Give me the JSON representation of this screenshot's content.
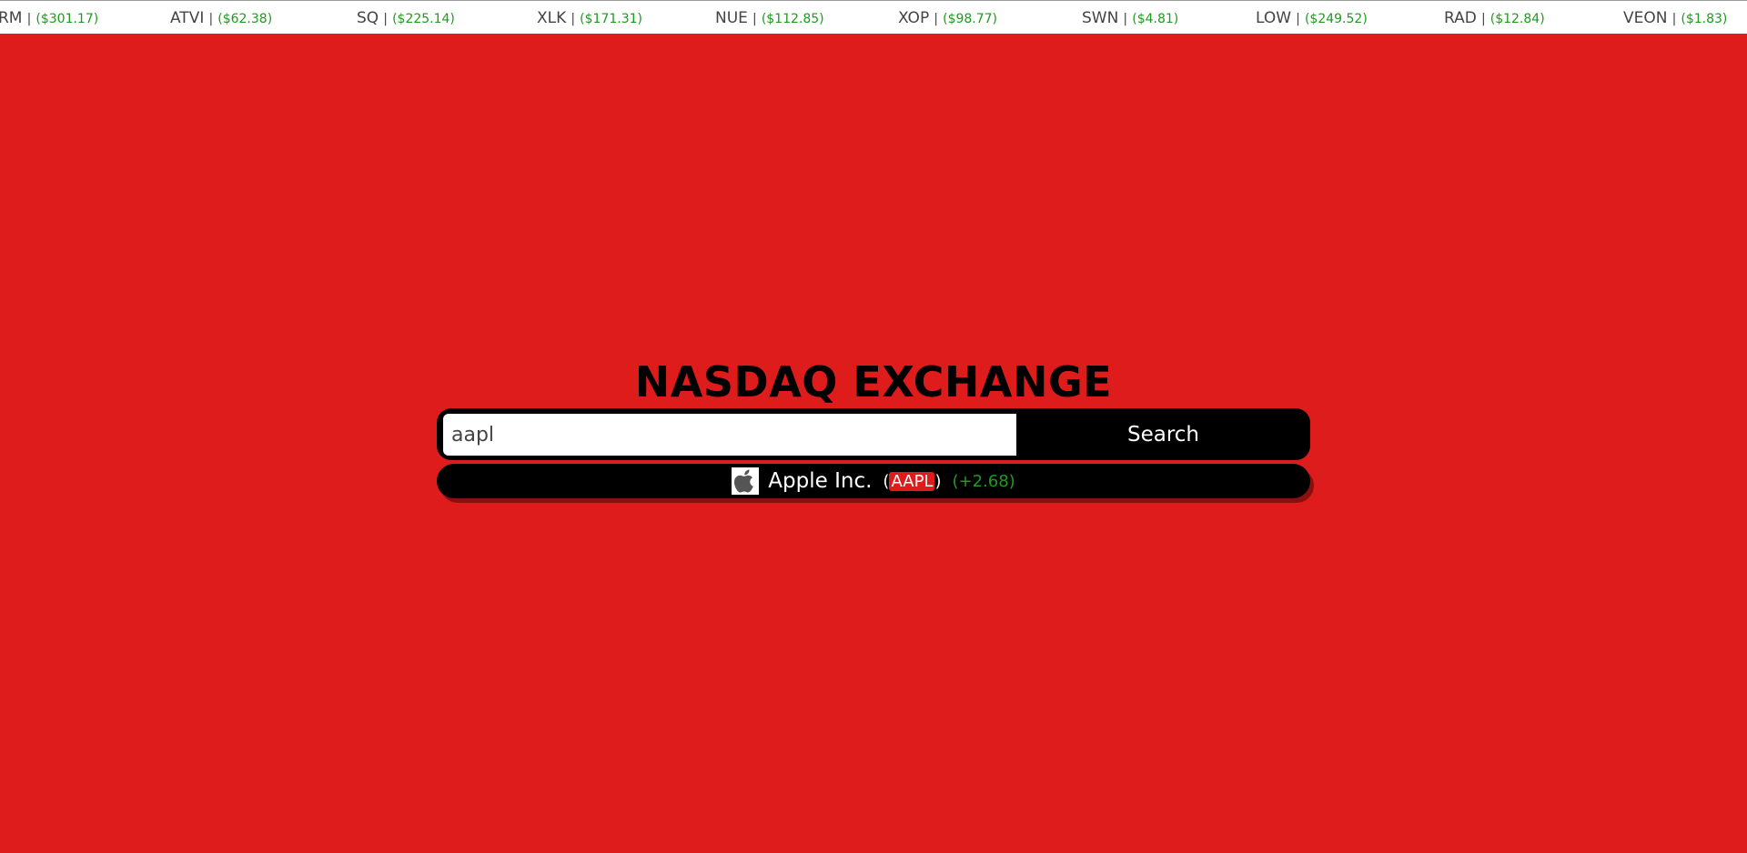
{
  "ticker": [
    {
      "symbol": "RM",
      "price": "($301.17)"
    },
    {
      "symbol": "ATVI",
      "price": "($62.38)"
    },
    {
      "symbol": "SQ",
      "price": "($225.14)"
    },
    {
      "symbol": "XLK",
      "price": "($171.31)"
    },
    {
      "symbol": "NUE",
      "price": "($112.85)"
    },
    {
      "symbol": "XOP",
      "price": "($98.77)"
    },
    {
      "symbol": "SWN",
      "price": "($4.81)"
    },
    {
      "symbol": "LOW",
      "price": "($249.52)"
    },
    {
      "symbol": "RAD",
      "price": "($12.84)"
    },
    {
      "symbol": "VEON",
      "price": "($1.83)"
    }
  ],
  "ticker_separator": "|",
  "title": "NASDAQ EXCHANGE",
  "search": {
    "value": "aapl",
    "button_label": "Search"
  },
  "result": {
    "logo_icon": "apple-logo-icon",
    "name": "Apple Inc.",
    "open_paren": "(",
    "symbol": "AAPL",
    "close_paren": ")",
    "change": "(+2.68)"
  },
  "colors": {
    "background": "#de1c1c",
    "ticker_background": "#ffffff",
    "price_green": "#1e9b1e",
    "bar_black": "#000000"
  }
}
